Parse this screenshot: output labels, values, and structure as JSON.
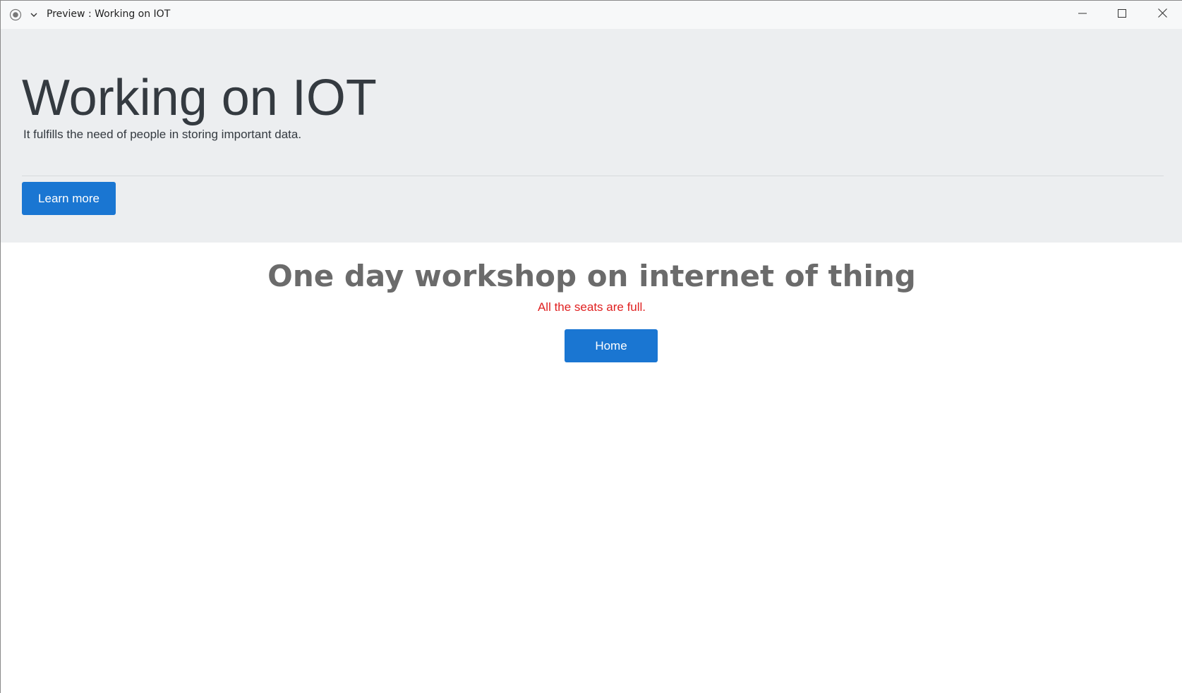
{
  "window": {
    "title": "Preview : Working on IOT",
    "icons": {
      "record": "record-icon",
      "chevron": "chevron-down-icon",
      "minimize": "minimize-icon",
      "maximize": "maximize-icon",
      "close": "close-icon"
    }
  },
  "jumbotron": {
    "title": "Working on IOT",
    "lead": "It fulfills the need of people in storing important data.",
    "button_label": "Learn more"
  },
  "main": {
    "heading": "One day workshop on internet of thing",
    "status": "All the seats are full.",
    "button_label": "Home"
  },
  "colors": {
    "accent": "#1a76d2",
    "jumbotron_bg": "#eceef0",
    "status_red": "#e02020",
    "heading_gray": "#6b6b6b"
  }
}
